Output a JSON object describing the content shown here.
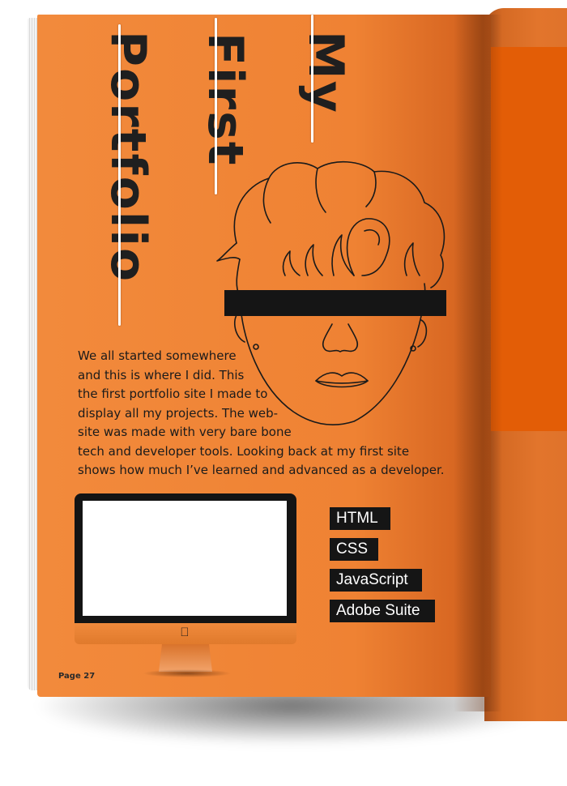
{
  "title": {
    "line1": "My",
    "line2": "First",
    "line3": "Portfolio"
  },
  "intro": {
    "lines": [
      "We all started somewhere",
      "and this is where I did. This",
      "the first portfolio site I made to",
      "display all my projects. The web-",
      "site was made with very bare bone",
      "tech and developer tools. Looking back at my first site",
      "shows how much I’ve learned and advanced as a developer."
    ]
  },
  "skills": [
    "HTML",
    "CSS",
    "JavaScript",
    "Adobe Suite"
  ],
  "page_number": "Page 27",
  "colors": {
    "page_orange": "#ef8233",
    "accent_block": "#e35d06",
    "ink": "#151515"
  },
  "icons": {
    "monitor": "monitor-icon",
    "apple": "apple-logo-icon"
  }
}
